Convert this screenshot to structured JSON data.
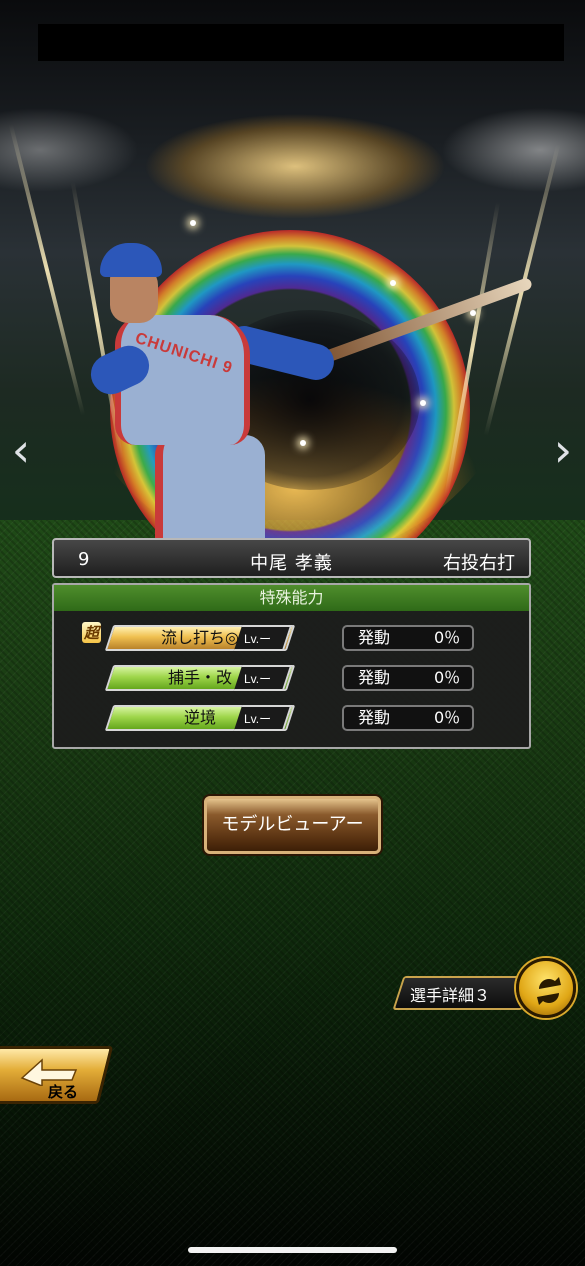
{
  "player": {
    "number": "9",
    "name": "中尾 孝義",
    "handedness": "右投右打"
  },
  "special_abilities": {
    "title": "特殊能力",
    "items": [
      {
        "label": "流し打ち◎",
        "prefix": "超",
        "level": "Lv.ー",
        "activation_label": "発動",
        "activation_value": "0％",
        "color": "#f0c050"
      },
      {
        "label": "捕手・改",
        "level": "Lv.ー",
        "activation_label": "発動",
        "activation_value": "0％",
        "color": "#9fd64b"
      },
      {
        "label": "逆境",
        "level": "Lv.ー",
        "activation_label": "発動",
        "activation_value": "0％",
        "color": "#9fd64b"
      }
    ]
  },
  "buttons": {
    "model_viewer": "モデルビューアー",
    "player_detail": "選手詳細３",
    "back": "戻る"
  },
  "icons": {
    "prev": "chevron-left-icon",
    "next": "chevron-right-icon",
    "swap": "swap-arrows-icon",
    "back": "back-arrow-icon"
  },
  "colors": {
    "ability_header": "#3f7c22",
    "button_brown": "#6a3e16",
    "gold": "#e0a716"
  }
}
